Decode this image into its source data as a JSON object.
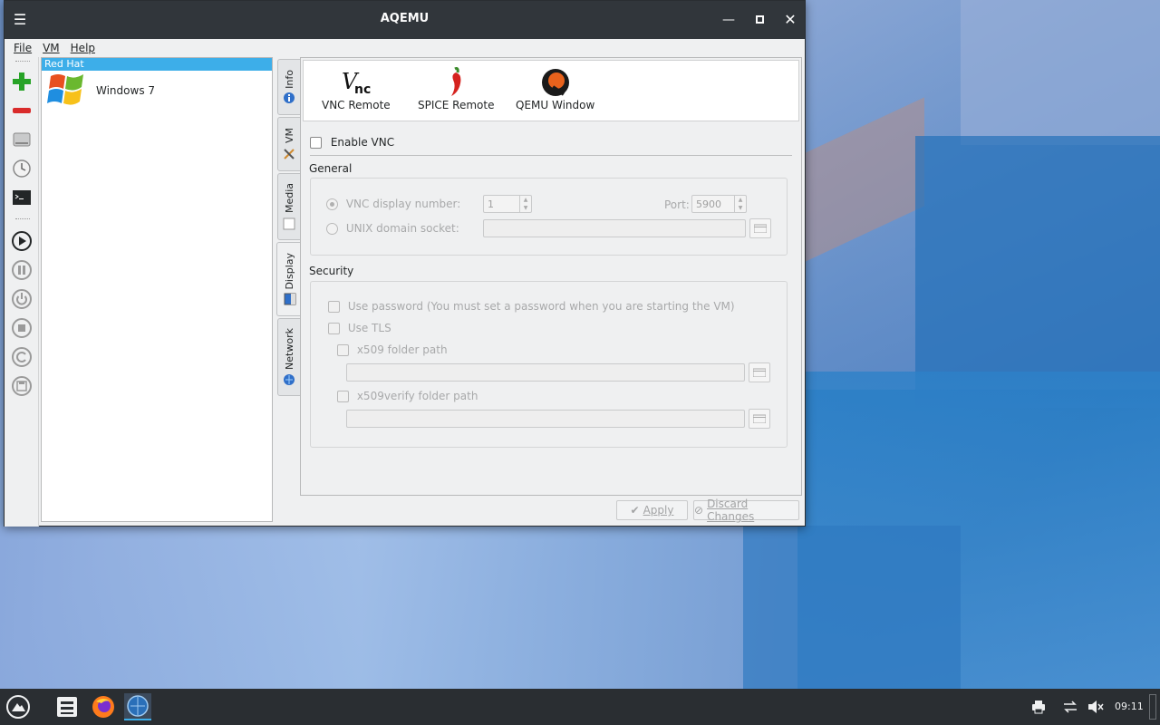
{
  "window": {
    "title": "AQEMU"
  },
  "menu": [
    "File",
    "VM",
    "Help"
  ],
  "vm_list": {
    "group": "Red Hat",
    "items": [
      {
        "name": "Windows 7"
      }
    ]
  },
  "side_tabs": [
    "Info",
    "VM",
    "Media",
    "Display",
    "Network"
  ],
  "connections": [
    "VNC Remote",
    "SPICE Remote",
    "QEMU Window"
  ],
  "vnc": {
    "enable_label": "Enable VNC",
    "general_title": "General",
    "display_number_label": "VNC display number:",
    "display_number_value": "1",
    "port_label": "Port:",
    "port_value": "5900",
    "unix_socket_label": "UNIX domain socket:",
    "security_title": "Security",
    "use_password_label": "Use password (You must set a password when you are starting the VM)",
    "use_tls_label": "Use TLS",
    "x509_label": "x509 folder path",
    "x509verify_label": "x509verify folder path"
  },
  "buttons": {
    "apply": "Apply",
    "discard": "Discard Changes"
  },
  "tray": {
    "clock": "09:11"
  },
  "colors": {
    "accent": "#3daee9",
    "titlebar": "#31363b",
    "taskbar": "#2a2e32"
  }
}
